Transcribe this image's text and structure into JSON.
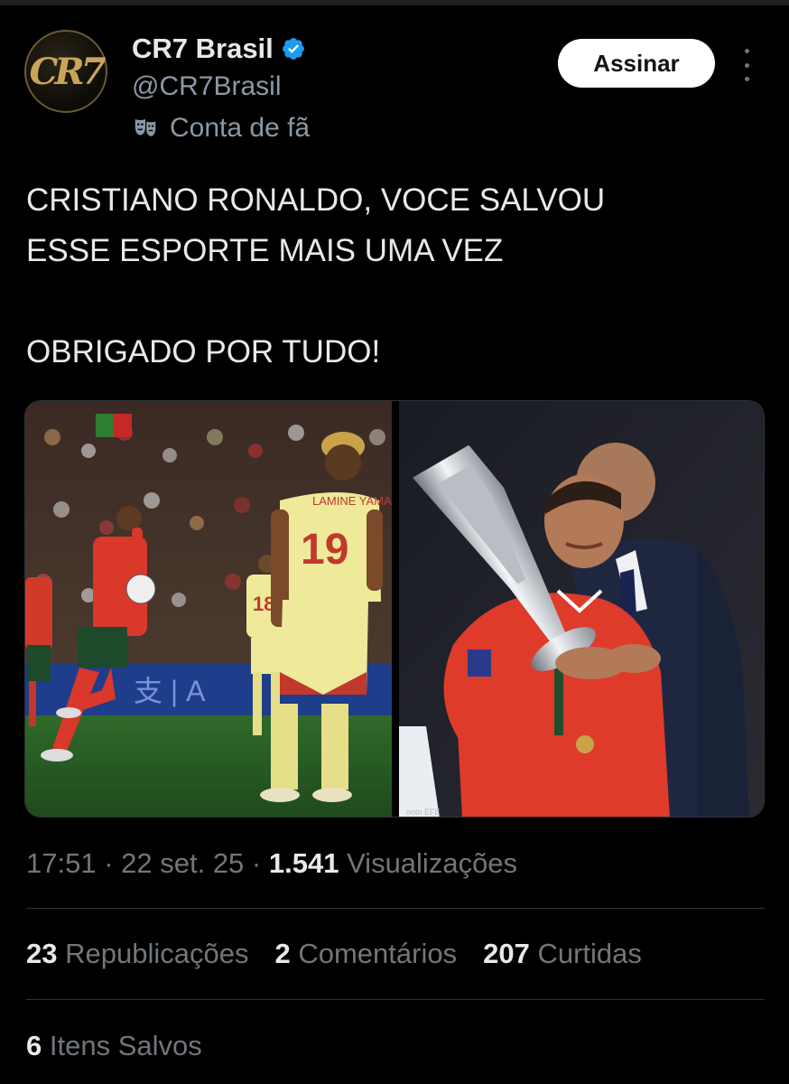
{
  "account": {
    "avatar_text": "CR7",
    "name": "CR7 Brasil",
    "handle": "@CR7Brasil",
    "fan_label": "Conta de fã",
    "verified_icon": "verified-badge-icon",
    "fan_icon": "theater-mask-icon"
  },
  "actions": {
    "subscribe_label": "Assinar",
    "more_icon": "more-vertical-icon"
  },
  "tweet": {
    "line1": "CRISTIANO RONALDO, VOCE SALVOU",
    "line2": "ESSE ESPORTE MAIS UMA VEZ",
    "line3": "OBRIGADO POR TUDO!"
  },
  "media": {
    "image1": {
      "jersey_name": "LAMINE YAMAL",
      "jersey_number": "19",
      "second_number": "18"
    },
    "image2": {}
  },
  "meta": {
    "time": "17:51",
    "date": "22 set. 25",
    "views_count": "1.541",
    "views_label": "Visualizações"
  },
  "stats": {
    "reposts_count": "23",
    "reposts_label": "Republicações",
    "comments_count": "2",
    "comments_label": "Comentários",
    "likes_count": "207",
    "likes_label": "Curtidas",
    "saved_count": "6",
    "saved_label": "Itens Salvos"
  },
  "colors": {
    "background": "#000000",
    "text": "#e7e9ea",
    "muted": "#71767b",
    "verified": "#1d9bf0",
    "avatar_gold": "#c9a55a"
  }
}
